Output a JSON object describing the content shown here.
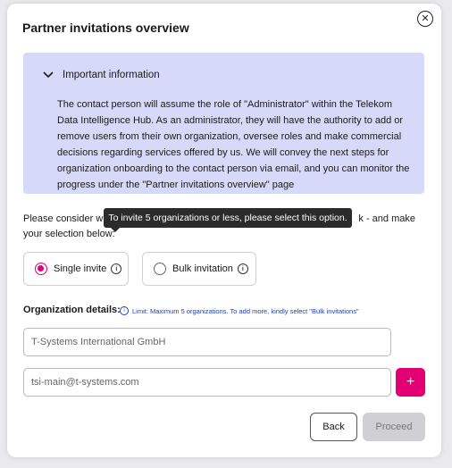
{
  "modal": {
    "title": "Partner invitations overview",
    "close_icon": "close-circle-icon"
  },
  "info": {
    "heading": "Important information",
    "body": "The contact person will assume the role of \"Administrator\" within the Telekom Data Intelligence Hub. As an administrator, they will have the authority to add or remove users from their own organization, oversee roles and make commercial decisions regarding services offered by us. We will convey the next steps for organization onboarding to the contact person via email, and you can monitor the progress under the \"Partner invitations overview\" page"
  },
  "selection": {
    "prompt_start": "Please consider wh",
    "prompt_end": "k - and make your selection below:",
    "tooltip": "To invite 5 organizations or less, please select this option.",
    "options": [
      {
        "label": "Single invite",
        "selected": true
      },
      {
        "label": "Bulk invitation",
        "selected": false
      }
    ]
  },
  "org": {
    "label": "Organization details:",
    "limit_note": "Limit: Maximum 5 organizations. To add more, kindly select \"Bulk invitations\"",
    "name_value": "T-Systems International GmbH",
    "email_value": "tsi-main@t-systems.com",
    "add_label": "+"
  },
  "actions": {
    "back": "Back",
    "proceed": "Proceed"
  },
  "colors": {
    "accent": "#e20074",
    "info_bg": "#d6d9f7",
    "link": "#1a3fc2"
  }
}
